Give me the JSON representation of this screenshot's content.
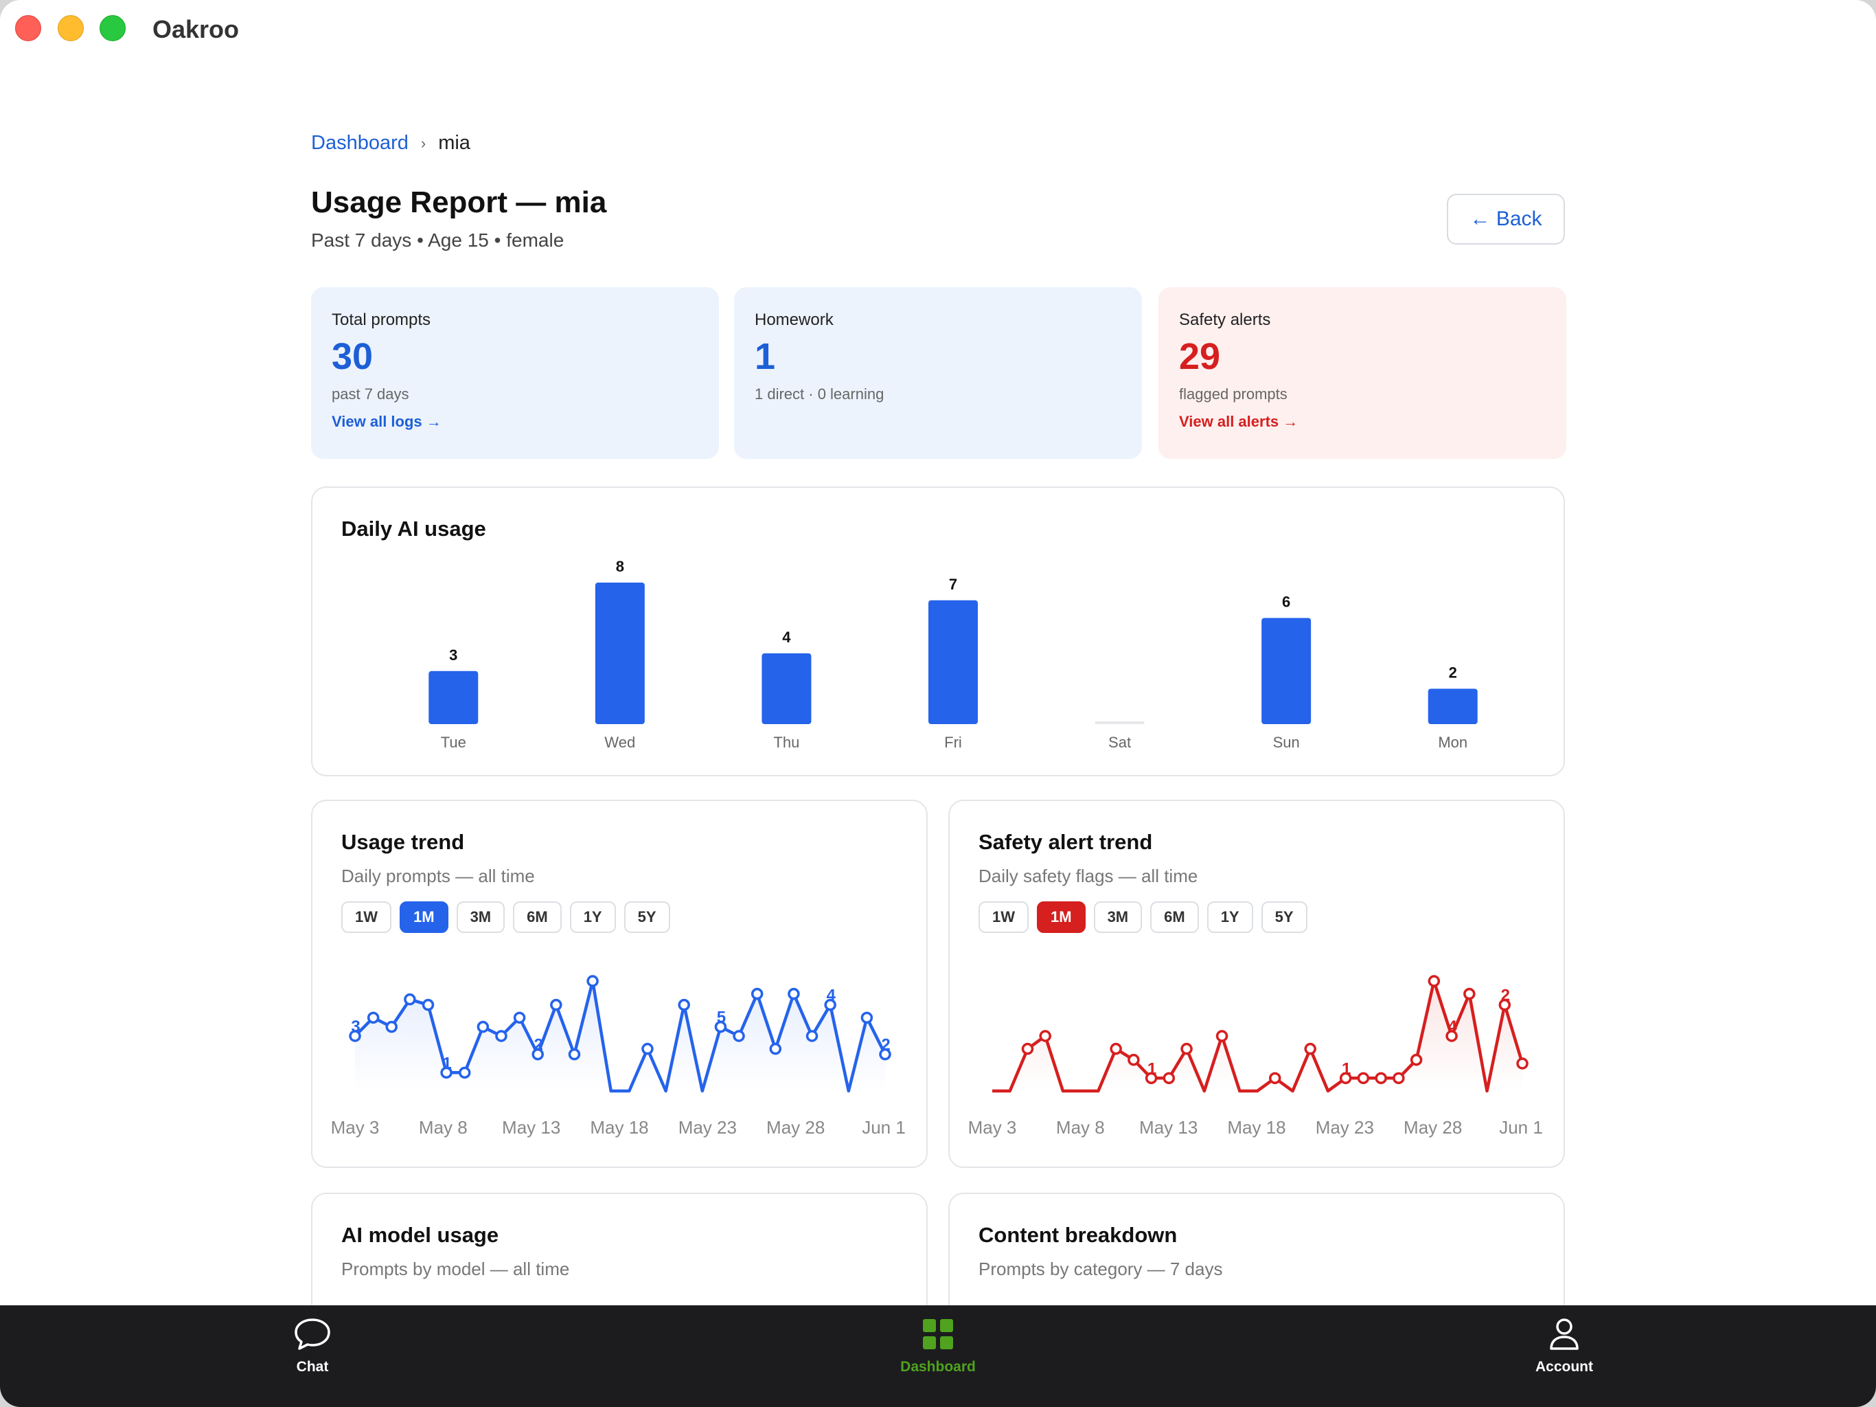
{
  "window": {
    "title": "Oakroo"
  },
  "breadcrumb": {
    "root": "Dashboard",
    "separator": "›",
    "current": "mia"
  },
  "header": {
    "title": "Usage Report — mia",
    "subtitle": "Past 7 days • Age 15 • female",
    "back_label": "← Back"
  },
  "stats": [
    {
      "label": "Total prompts",
      "value": "30",
      "note": "past 7 days",
      "link": "View all logs →"
    },
    {
      "label": "Homework",
      "value": "1",
      "note": "1 direct · 0 learning",
      "link": ""
    },
    {
      "label": "Safety alerts",
      "value": "29",
      "note": "flagged prompts",
      "link": "View all alerts →"
    }
  ],
  "colors": {
    "accent_blue": "#2563eb",
    "alert_red": "#d61f1f",
    "tab_active": "#4fa31f"
  },
  "daily_usage": {
    "title": "Daily AI usage",
    "chart_data": {
      "type": "bar",
      "categories": [
        "Tue",
        "Wed",
        "Thu",
        "Fri",
        "Sat",
        "Sun",
        "Mon"
      ],
      "values": [
        3,
        8,
        4,
        7,
        0,
        6,
        2
      ],
      "title": "Daily AI usage",
      "ylim": [
        0,
        8
      ],
      "grid": false
    }
  },
  "usage_trend": {
    "title": "Usage trend",
    "subtitle": "Daily prompts — all time",
    "ranges": [
      "1W",
      "1M",
      "3M",
      "6M",
      "1Y",
      "5Y"
    ],
    "active_range": "1M",
    "chart_data": {
      "type": "line",
      "x_ticks": [
        "May 3",
        "May 8",
        "May 13",
        "May 18",
        "May 23",
        "May 28",
        "Jun 1"
      ],
      "values": [
        3,
        4,
        3.5,
        5,
        4.7,
        1,
        1,
        3.5,
        3,
        4,
        2,
        4.7,
        2,
        6,
        0,
        0,
        2.3,
        0,
        4.7,
        0,
        3.5,
        3,
        5.3,
        2.3,
        5.3,
        3,
        4.7,
        0,
        4,
        2
      ],
      "markers": [
        1,
        1,
        1,
        1,
        1,
        1,
        1,
        1,
        1,
        1,
        1,
        1,
        1,
        1,
        0,
        0,
        1,
        0,
        1,
        0,
        1,
        1,
        1,
        1,
        1,
        1,
        1,
        0,
        1,
        1
      ],
      "labels": [
        {
          "i": 0,
          "text": "3"
        },
        {
          "i": 5,
          "text": "1"
        },
        {
          "i": 10,
          "text": "2"
        },
        {
          "i": 20,
          "text": "5"
        },
        {
          "i": 26,
          "text": "4"
        },
        {
          "i": 29,
          "text": "2"
        }
      ],
      "ylim": [
        0,
        6
      ],
      "color": "#2563eb"
    }
  },
  "alert_trend": {
    "title": "Safety alert trend",
    "subtitle": "Daily safety flags — all time",
    "ranges": [
      "1W",
      "1M",
      "3M",
      "6M",
      "1Y",
      "5Y"
    ],
    "active_range": "1M",
    "chart_data": {
      "type": "line",
      "x_ticks": [
        "May 3",
        "May 8",
        "May 13",
        "May 18",
        "May 23",
        "May 28",
        "Jun 1"
      ],
      "values": [
        0,
        0,
        2.3,
        3,
        0,
        0,
        0,
        2.3,
        1.7,
        0.7,
        0.7,
        2.3,
        0,
        3,
        0,
        0,
        0.7,
        0,
        2.3,
        0,
        0.7,
        0.7,
        0.7,
        0.7,
        1.7,
        6,
        3,
        5.3,
        0,
        4.7,
        1.5
      ],
      "markers": [
        0,
        0,
        1,
        1,
        0,
        0,
        0,
        1,
        1,
        1,
        1,
        1,
        0,
        1,
        0,
        0,
        1,
        0,
        1,
        0,
        1,
        1,
        1,
        1,
        1,
        1,
        1,
        1,
        0,
        1,
        1
      ],
      "labels": [
        {
          "i": 9,
          "text": "1"
        },
        {
          "i": 20,
          "text": "1"
        },
        {
          "i": 26,
          "text": "4"
        },
        {
          "i": 29,
          "text": "2"
        }
      ],
      "ylim": [
        0,
        6
      ],
      "color": "#d61f1f"
    }
  },
  "model_usage": {
    "title": "AI model usage",
    "subtitle": "Prompts by model — all time"
  },
  "content_breakdown": {
    "title": "Content breakdown",
    "subtitle": "Prompts by category — 7 days"
  },
  "tabs": [
    {
      "label": "Chat",
      "icon": "chat-bubble-icon"
    },
    {
      "label": "Dashboard",
      "icon": "grid-icon"
    },
    {
      "label": "Account",
      "icon": "person-icon"
    }
  ]
}
